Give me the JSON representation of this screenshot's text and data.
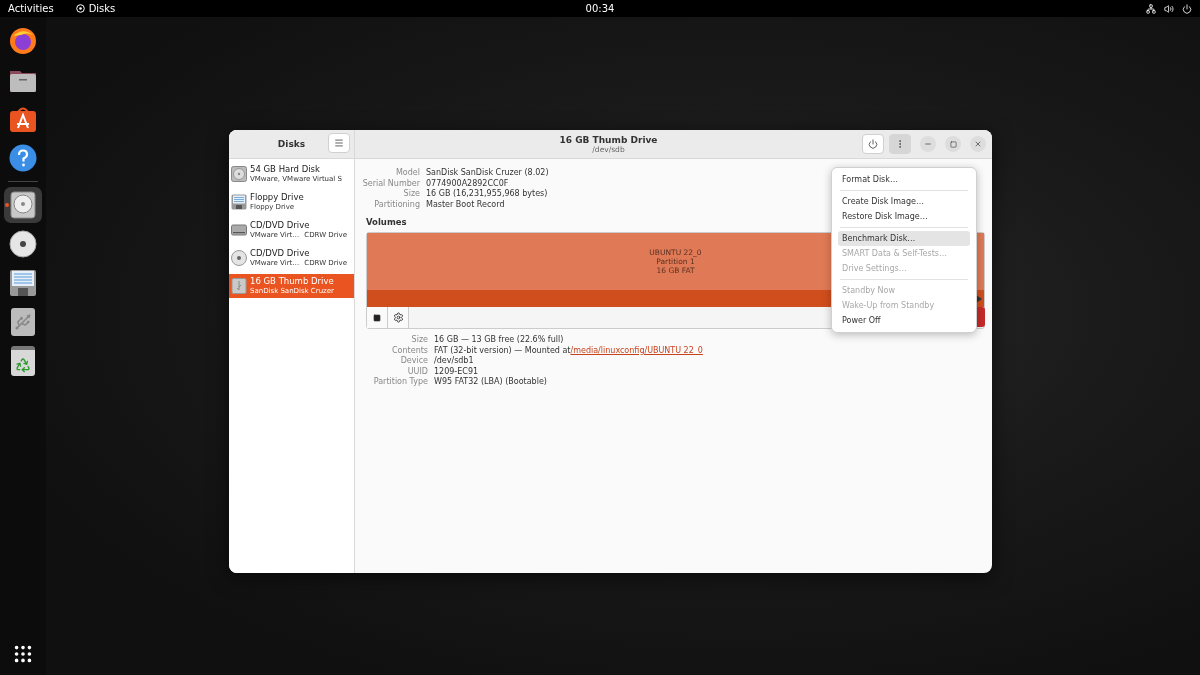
{
  "top_bar": {
    "activities": "Activities",
    "app_menu": "Disks",
    "clock": "00:34"
  },
  "dock": [
    {
      "kind": "browser",
      "running": false
    },
    {
      "kind": "files",
      "running": false
    },
    {
      "kind": "store",
      "running": false
    },
    {
      "kind": "help",
      "running": false
    },
    {
      "kind": "disks",
      "running": true
    },
    {
      "kind": "optical",
      "running": false
    },
    {
      "kind": "floppy",
      "running": false
    },
    {
      "kind": "usb",
      "running": false
    },
    {
      "kind": "trash",
      "running": false
    }
  ],
  "window": {
    "sidebar_title": "Disks",
    "title": "16 GB Thumb Drive",
    "subtitle": "/dev/sdb"
  },
  "drives": [
    {
      "kind": "hdd",
      "name": "54 GB Hard Disk",
      "detail": "VMware, VMware Virtual S",
      "selected": false
    },
    {
      "kind": "floppy",
      "name": "Floppy Drive",
      "detail": "Floppy Drive",
      "selected": false
    },
    {
      "kind": "optical-tray",
      "name": "CD/DVD Drive",
      "detail": "VMware Virt…",
      "media": "CDRW Drive",
      "selected": false
    },
    {
      "kind": "optical",
      "name": "CD/DVD Drive",
      "detail": "VMware Virt…",
      "media": "CDRW Drive",
      "selected": false
    },
    {
      "kind": "usb",
      "name": "16 GB Thumb Drive",
      "detail": "SanDisk SanDisk Cruzer",
      "selected": true
    }
  ],
  "disk_info": [
    {
      "label": "Model",
      "value": "SanDisk SanDisk Cruzer (8.02)"
    },
    {
      "label": "Serial Number",
      "value": "0774900A2892CC0F"
    },
    {
      "label": "Size",
      "value": "16 GB (16,231,955,968 bytes)"
    },
    {
      "label": "Partitioning",
      "value": "Master Boot Record"
    }
  ],
  "volumes": {
    "heading": "Volumes",
    "partition": {
      "name": "UBUNTU 22_0",
      "number": "Partition 1",
      "summary": "16 GB FAT",
      "selected": true
    }
  },
  "volume_info": [
    {
      "label": "Size",
      "value": "16 GB — 13 GB free (22.6% full)"
    },
    {
      "label": "Contents",
      "value": "FAT (32-bit version) — Mounted at ",
      "link": "/media/linuxconfig/UBUNTU 22_0"
    },
    {
      "label": "Device",
      "value": "/dev/sdb1"
    },
    {
      "label": "UUID",
      "value": "1209-EC91"
    },
    {
      "label": "Partition Type",
      "value": "W95 FAT32 (LBA) (Bootable)"
    }
  ],
  "menu": [
    [
      {
        "label": "Format Disk…",
        "disabled": false,
        "selected": false
      }
    ],
    [
      {
        "label": "Create Disk Image…",
        "disabled": false,
        "selected": false
      },
      {
        "label": "Restore Disk Image…",
        "disabled": false,
        "selected": false
      }
    ],
    [
      {
        "label": "Benchmark Disk…",
        "disabled": false,
        "selected": true
      },
      {
        "label": "SMART Data & Self-Tests…",
        "disabled": true,
        "selected": false
      },
      {
        "label": "Drive Settings…",
        "disabled": true,
        "selected": false
      }
    ],
    [
      {
        "label": "Standby Now",
        "disabled": true,
        "selected": false
      },
      {
        "label": "Wake-Up from Standby",
        "disabled": true,
        "selected": false
      },
      {
        "label": "Power Off",
        "disabled": false,
        "selected": false
      }
    ]
  ]
}
